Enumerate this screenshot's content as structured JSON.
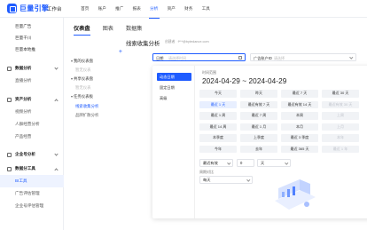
{
  "brand": {
    "name": "巨量引擎",
    "workbench": "工作台",
    "accent": "#1f5cff"
  },
  "topnav": {
    "items": [
      {
        "label": "首页"
      },
      {
        "label": "账户"
      },
      {
        "label": "推广"
      },
      {
        "label": "报表"
      },
      {
        "label": "分析",
        "active": true
      },
      {
        "label": "资产"
      },
      {
        "label": "财务"
      },
      {
        "label": "工具"
      }
    ]
  },
  "sidebar": {
    "items": [
      {
        "label": "巨量广告",
        "type": "link"
      },
      {
        "label": "巨量千川",
        "type": "link"
      },
      {
        "label": "巨量本地推",
        "type": "link"
      },
      {
        "label": "数据分析",
        "type": "group",
        "collapsed": true
      },
      {
        "label": "直播分析",
        "type": "child"
      },
      {
        "label": "资产分析",
        "type": "group",
        "collapsed": false
      },
      {
        "label": "视频分析",
        "type": "child"
      },
      {
        "label": "人群经营分析",
        "type": "child"
      },
      {
        "label": "产品经营",
        "type": "child"
      },
      {
        "label": "企业号分析",
        "type": "group",
        "collapsed": true
      },
      {
        "label": "数据分工具",
        "type": "group",
        "collapsed": false
      },
      {
        "label": "BI工具",
        "type": "child",
        "active": true
      },
      {
        "label": "广告评估管理",
        "type": "child"
      },
      {
        "label": "企业号评估管理",
        "type": "child"
      }
    ]
  },
  "main": {
    "tabs": [
      {
        "label": "仪表盘",
        "active": true
      },
      {
        "label": "图表"
      },
      {
        "label": "数据集"
      }
    ]
  },
  "tree": {
    "items": [
      {
        "label": "我的仪表盘",
        "type": "group"
      },
      {
        "label": "暂无仪表",
        "type": "sub"
      },
      {
        "label": "共享仪表盘",
        "type": "group"
      },
      {
        "label": "暂无仪表",
        "type": "sub"
      },
      {
        "label": "任务仪表板",
        "type": "group"
      },
      {
        "label": "线索收集分析",
        "type": "sub",
        "active": true
      },
      {
        "label": "品牌扩散分析",
        "type": "sub",
        "strong": true
      }
    ]
  },
  "analysis": {
    "title": "线索收集分析",
    "creator_label": "创建者",
    "creator_value": "f***@bytedance.com"
  },
  "filters": {
    "date_label": "日期",
    "date_placeholder": "请选择时间",
    "account_label": "广告账户ID",
    "account_placeholder": "请选择"
  },
  "datepicker": {
    "modes": [
      {
        "label": "动态日期",
        "active": true
      },
      {
        "label": "固定日期"
      },
      {
        "label": "高级"
      }
    ],
    "hint": "时间范围",
    "range_text": "2024-04-29 ~ 2024-04-29",
    "quick": [
      {
        "label": "今天"
      },
      {
        "label": "昨天"
      },
      {
        "label": "最近 7 天"
      },
      {
        "label": "最近 30 天"
      },
      {
        "label": "最近 1 天",
        "selected": true
      },
      {
        "label": "最近有效 7 天"
      },
      {
        "label": "最近有效 14 天"
      },
      {
        "label": "最近有效 30 天",
        "dim": true
      },
      {
        "label": "最近 1 周"
      },
      {
        "label": "最近 7 周"
      },
      {
        "label": "本周"
      },
      {
        "label": "上周",
        "dim": true
      },
      {
        "label": "最近 14 周"
      },
      {
        "label": "最近 1 月"
      },
      {
        "label": "本月"
      },
      {
        "label": "上月",
        "dim": true
      },
      {
        "label": "本季度"
      },
      {
        "label": "上季度"
      },
      {
        "label": "最近 3 季度"
      },
      {
        "label": "本年",
        "dim": true
      },
      {
        "label": "今年"
      },
      {
        "label": "去年"
      },
      {
        "label": "最近 365 天"
      },
      {
        "label": "最近 1 年",
        "dim": true
      }
    ],
    "custom": {
      "direction": "最近有效",
      "count": "0",
      "unit": "天"
    },
    "compare_label": "周期对比",
    "compare_value": "每天"
  }
}
